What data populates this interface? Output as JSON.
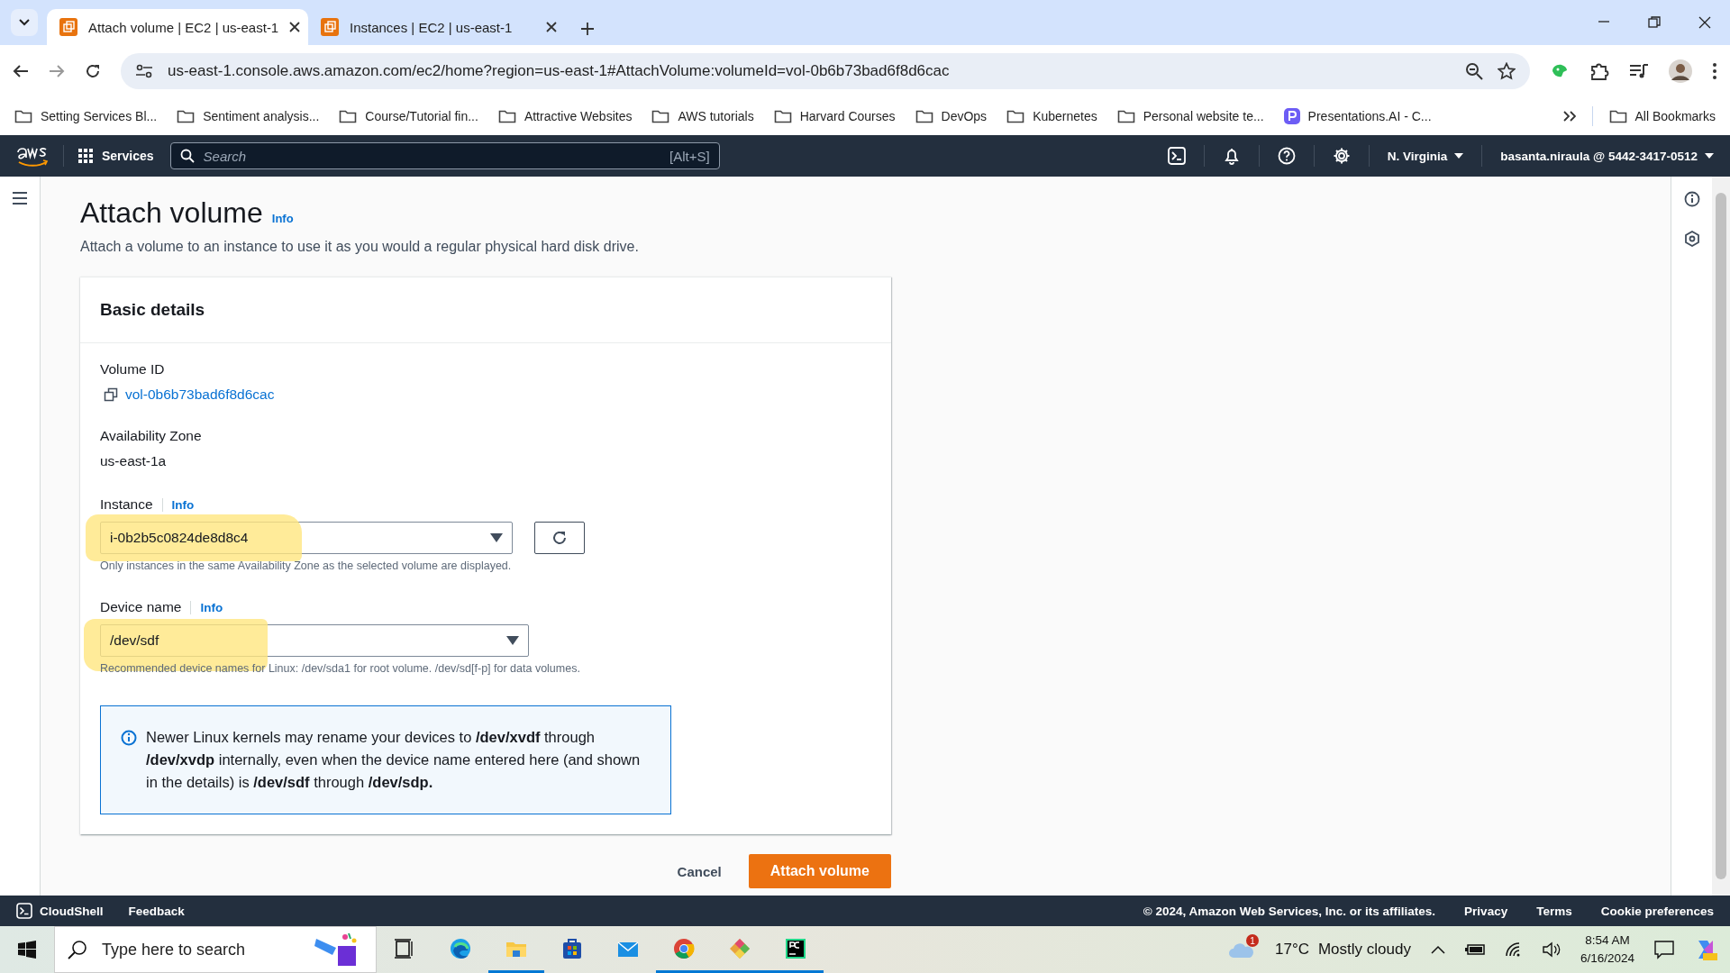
{
  "browser": {
    "tabs": [
      {
        "title": "Attach volume | EC2 | us-east-1",
        "selected": true
      },
      {
        "title": "Instances | EC2 | us-east-1",
        "selected": false
      }
    ],
    "url": "us-east-1.console.aws.amazon.com/ec2/home?region=us-east-1#AttachVolume:volumeId=vol-0b6b73bad6f8d6cac",
    "bookmarks": [
      {
        "label": "Setting Services Bl...",
        "kind": "folder"
      },
      {
        "label": "Sentiment analysis...",
        "kind": "folder"
      },
      {
        "label": "Course/Tutorial fin...",
        "kind": "folder"
      },
      {
        "label": "Attractive Websites",
        "kind": "folder"
      },
      {
        "label": "AWS tutorials",
        "kind": "folder"
      },
      {
        "label": "Harvard Courses",
        "kind": "folder"
      },
      {
        "label": "DevOps",
        "kind": "folder"
      },
      {
        "label": "Kubernetes",
        "kind": "folder"
      },
      {
        "label": "Personal website te...",
        "kind": "folder"
      },
      {
        "label": "Presentations.AI - C...",
        "kind": "site"
      }
    ],
    "all_bookmarks": "All Bookmarks"
  },
  "console_nav": {
    "services": "Services",
    "search_placeholder": "Search",
    "shortcut": "[Alt+S]",
    "region": "N. Virginia",
    "account": "basanta.niraula @ 5442-3417-0512"
  },
  "page": {
    "title": "Attach volume",
    "info": "Info",
    "description": "Attach a volume to an instance to use it as you would a regular physical hard disk drive."
  },
  "basic_details": {
    "title": "Basic details",
    "volume_id": {
      "label": "Volume ID",
      "value": "vol-0b6b73bad6f8d6cac"
    },
    "availability_zone": {
      "label": "Availability Zone",
      "value": "us-east-1a"
    },
    "instance": {
      "label": "Instance",
      "info": "Info",
      "value": "i-0b2b5c0824de8d8c4",
      "hint": "Only instances in the same Availability Zone as the selected volume are displayed.",
      "highlighted": true
    },
    "device_name": {
      "label": "Device name",
      "info": "Info",
      "value": "/dev/sdf",
      "hint": "Recommended device names for Linux: /dev/sda1 for root volume. /dev/sd[f-p] for data volumes.",
      "highlighted": true
    },
    "alert": "Newer Linux kernels may rename your devices to **/dev/xvdf** through **/dev/xvdp** internally, even when the device name entered here (and shown in the details) is **/dev/sdf** through **/dev/sdp.**"
  },
  "actions": {
    "cancel": "Cancel",
    "submit": "Attach volume"
  },
  "footer": {
    "cloudshell": "CloudShell",
    "feedback": "Feedback",
    "copyright": "© 2024, Amazon Web Services, Inc. or its affiliates.",
    "links": [
      "Privacy",
      "Terms",
      "Cookie preferences"
    ]
  },
  "taskbar": {
    "search_placeholder": "Type here to search",
    "weather_badge": "1",
    "temperature": "17°C",
    "weather": "Mostly cloudy",
    "time": "8:54 AM",
    "date": "6/16/2024",
    "apps": [
      {
        "kind": "taskview",
        "running": false
      },
      {
        "kind": "edge",
        "running": false
      },
      {
        "kind": "explorer",
        "running": true
      },
      {
        "kind": "store",
        "running": false
      },
      {
        "kind": "mail",
        "running": false
      },
      {
        "kind": "chrome",
        "running": true
      },
      {
        "kind": "git",
        "running": true
      },
      {
        "kind": "pycharm",
        "running": true
      }
    ]
  }
}
